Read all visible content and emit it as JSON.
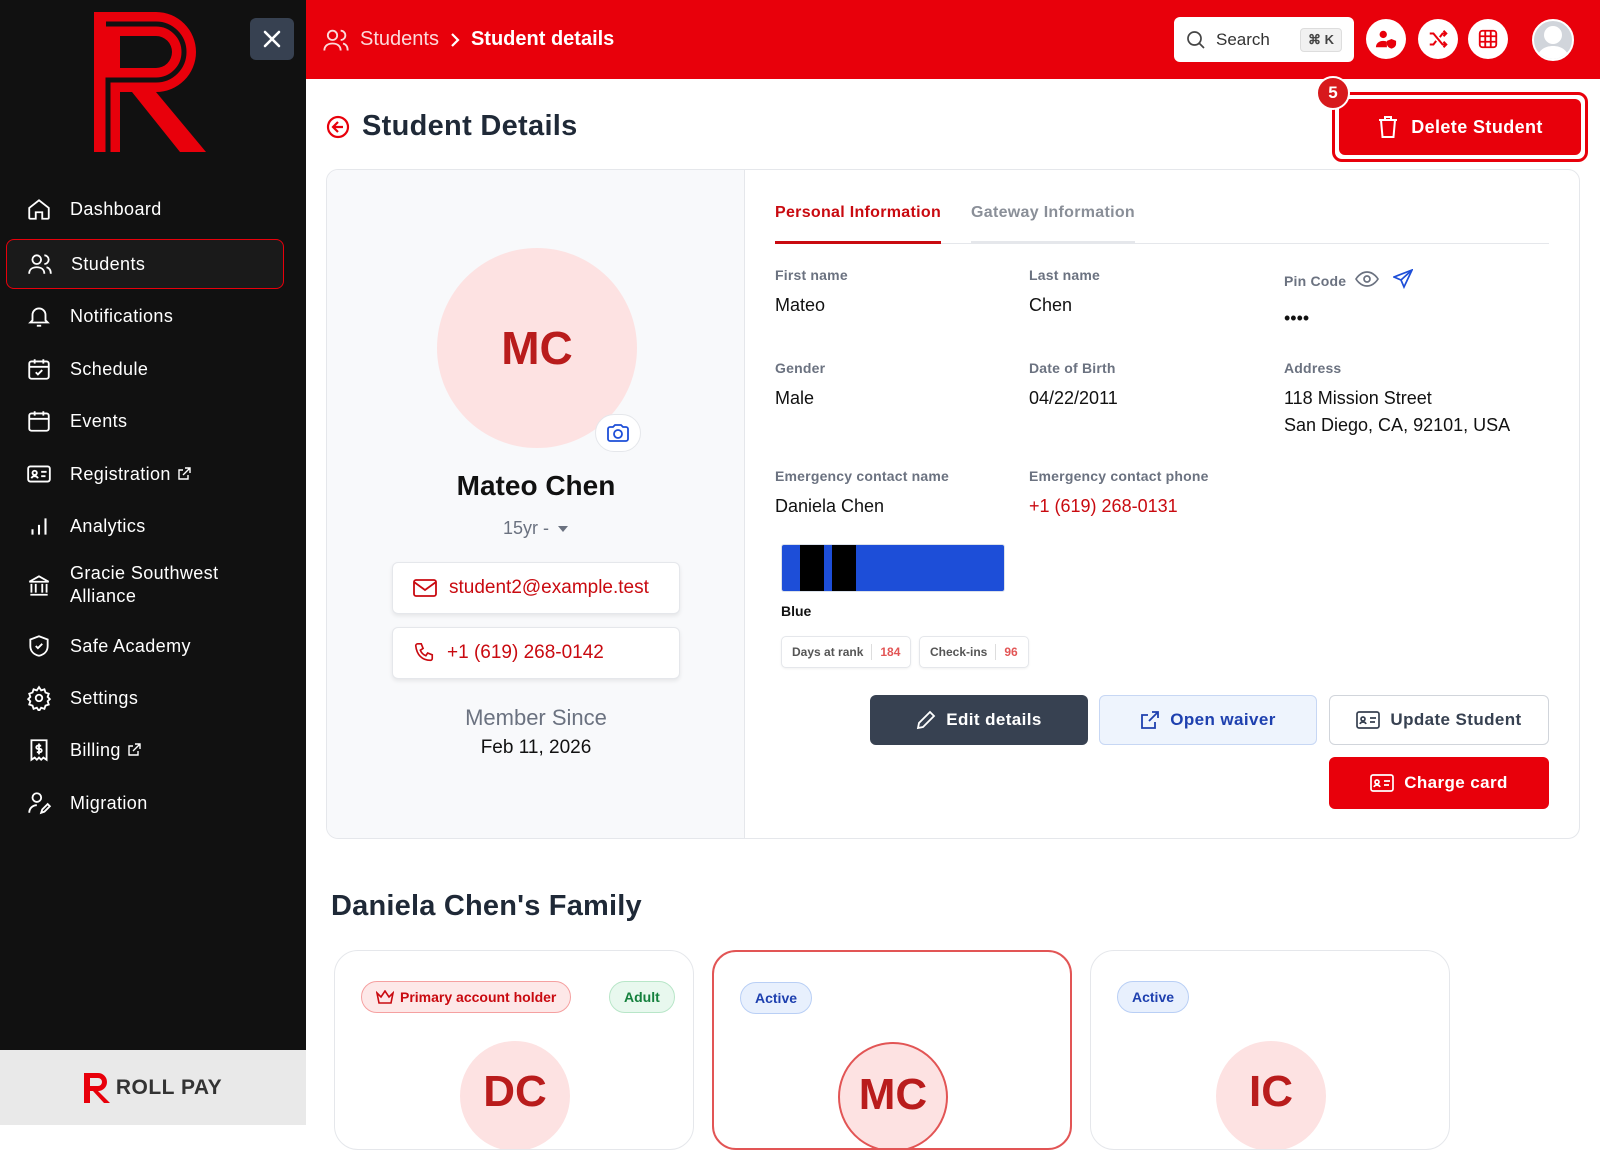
{
  "sidebar": {
    "items": [
      {
        "label": "Dashboard",
        "icon": "home-icon"
      },
      {
        "label": "Students",
        "icon": "users-icon",
        "active": true
      },
      {
        "label": "Notifications",
        "icon": "bell-icon"
      },
      {
        "label": "Schedule",
        "icon": "calendar-check-icon"
      },
      {
        "label": "Events",
        "icon": "calendar-icon"
      },
      {
        "label": "Registration",
        "icon": "id-card-icon",
        "external": true
      },
      {
        "label": "Analytics",
        "icon": "bar-chart-icon"
      },
      {
        "label": "Gracie Southwest\nAlliance",
        "icon": "bank-icon"
      },
      {
        "label": "Safe Academy",
        "icon": "shield-icon"
      },
      {
        "label": "Settings",
        "icon": "gear-icon"
      },
      {
        "label": "Billing",
        "icon": "receipt-icon",
        "external": true
      },
      {
        "label": "Migration",
        "icon": "user-edit-icon"
      }
    ],
    "footer_brand": "ROLL PAY"
  },
  "header": {
    "breadcrumb_root": "Students",
    "breadcrumb_current": "Student details",
    "search_label": "Search",
    "search_shortcut": "⌘ K"
  },
  "page": {
    "title": "Student Details",
    "delete_label": "Delete Student",
    "step_badge": "5"
  },
  "profile": {
    "initials": "MC",
    "name": "Mateo Chen",
    "age": "15yr -",
    "email": "student2@example.test",
    "phone": "+1 (619) 268-0142",
    "member_since_label": "Member Since",
    "member_since": "Feb 11, 2026"
  },
  "tabs": {
    "personal": "Personal Information",
    "gateway": "Gateway Information"
  },
  "fields": {
    "first_name_label": "First name",
    "first_name": "Mateo",
    "last_name_label": "Last name",
    "last_name": "Chen",
    "pin_label": "Pin Code",
    "pin": "••••",
    "gender_label": "Gender",
    "gender": "Male",
    "dob_label": "Date of Birth",
    "dob": "04/22/2011",
    "address_label": "Address",
    "address_line1": "118 Mission Street",
    "address_line2": "San Diego, CA, 92101, USA",
    "ec_name_label": "Emergency contact name",
    "ec_name": "Daniela Chen",
    "ec_phone_label": "Emergency contact phone",
    "ec_phone": "+1 (619) 268-0131"
  },
  "rank": {
    "belt": "Blue",
    "belt_color": "#1d4ed8",
    "days_label": "Days at rank",
    "days": "184",
    "checkins_label": "Check-ins",
    "checkins": "96"
  },
  "actions": {
    "edit": "Edit details",
    "waiver": "Open waiver",
    "update": "Update Student",
    "charge": "Charge card"
  },
  "family": {
    "title": "Daniela Chen's Family",
    "members": [
      {
        "initials": "DC",
        "tags": [
          "Primary account holder",
          "Adult"
        ]
      },
      {
        "initials": "MC",
        "tags": [
          "Active"
        ],
        "selected": true
      },
      {
        "initials": "IC",
        "tags": [
          "Active"
        ]
      }
    ]
  },
  "colors": {
    "brand": "#e8000b",
    "sidebar_bg": "#111111"
  }
}
